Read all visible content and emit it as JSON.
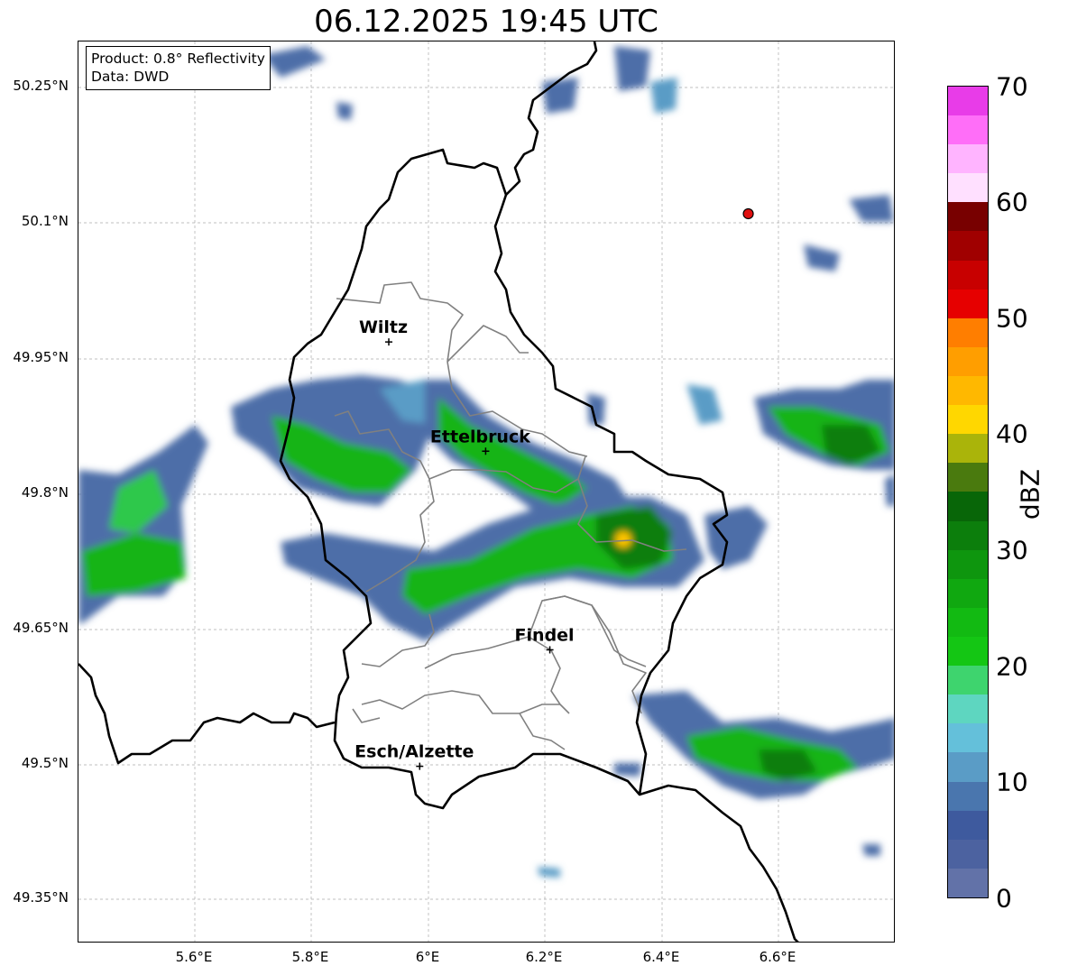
{
  "title": "06.12.2025 19:45 UTC",
  "info": {
    "product": "Product: 0.8° Reflectivity",
    "data": "Data: DWD"
  },
  "lat_ticks": [
    "50.25°N",
    "50.1°N",
    "49.95°N",
    "49.8°N",
    "49.65°N",
    "49.5°N",
    "49.35°N"
  ],
  "lon_ticks": [
    "5.6°E",
    "5.8°E",
    "6°E",
    "6.2°E",
    "6.4°E",
    "6.6°E"
  ],
  "colorbar": {
    "label": "dBZ",
    "ticks": [
      "0",
      "10",
      "20",
      "30",
      "40",
      "50",
      "60",
      "70"
    ],
    "colors": [
      "#6272a8",
      "#4c62a0",
      "#3e5a9e",
      "#4a76ae",
      "#5a9cc6",
      "#64c0da",
      "#5ed6c0",
      "#3ed46e",
      "#14c614",
      "#12ba12",
      "#10a810",
      "#0e960e",
      "#0c7e0c",
      "#086608",
      "#4a7a0e",
      "#aab40a",
      "#ffd700",
      "#ffb800",
      "#ff9e00",
      "#ff7e00",
      "#e60000",
      "#c80000",
      "#a00000",
      "#780000",
      "#ffe0ff",
      "#ffb4ff",
      "#ff6ef8",
      "#e83ce8"
    ]
  },
  "cities": [
    {
      "name": "Wiltz",
      "lat": 49.968,
      "lon": 5.932
    },
    {
      "name": "Ettelbruck",
      "lat": 49.847,
      "lon": 6.098
    },
    {
      "name": "Findel",
      "lat": 49.627,
      "lon": 6.208
    },
    {
      "name": "Esch/Alzette",
      "lat": 49.498,
      "lon": 5.985
    }
  ],
  "radar_site": {
    "lat": 50.11,
    "lon": 6.548,
    "color": "#e01010"
  }
}
